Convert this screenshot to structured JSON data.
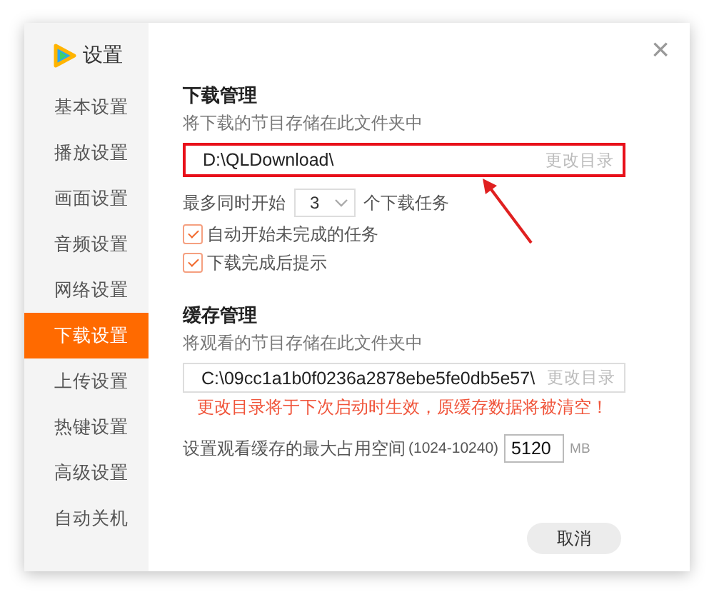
{
  "window": {
    "title": "设置",
    "close": "×"
  },
  "sidebar": {
    "items": [
      {
        "label": "基本设置",
        "selected": false
      },
      {
        "label": "播放设置",
        "selected": false
      },
      {
        "label": "画面设置",
        "selected": false
      },
      {
        "label": "音频设置",
        "selected": false
      },
      {
        "label": "网络设置",
        "selected": false
      },
      {
        "label": "下载设置",
        "selected": true
      },
      {
        "label": "上传设置",
        "selected": false
      },
      {
        "label": "热键设置",
        "selected": false
      },
      {
        "label": "高级设置",
        "selected": false
      },
      {
        "label": "自动关机",
        "selected": false
      }
    ]
  },
  "download": {
    "heading": "下载管理",
    "description": "将下载的节目存储在此文件夹中",
    "path": "D:\\QLDownload\\",
    "change_dir": "更改目录",
    "highlighted": true,
    "concurrent": {
      "prefix": "最多同时开始",
      "value": "3",
      "suffix": "个下载任务"
    },
    "options": [
      {
        "label": "自动开始未完成的任务",
        "checked": true
      },
      {
        "label": "下载完成后提示",
        "checked": true
      }
    ]
  },
  "cache": {
    "heading": "缓存管理",
    "description": "将观看的节目存储在此文件夹中",
    "path": "C:\\09cc1a1b0f0236a2878ebe5fe0db5e57\\",
    "change_dir": "更改目录",
    "warning": "更改目录将于下次启动时生效，原缓存数据将被清空！",
    "size": {
      "label": "设置观看缓存的最大占用空间",
      "range": "(1024-10240)",
      "value": "5120",
      "unit": "MB"
    }
  },
  "buttons": [
    {
      "label": "取消"
    }
  ]
}
